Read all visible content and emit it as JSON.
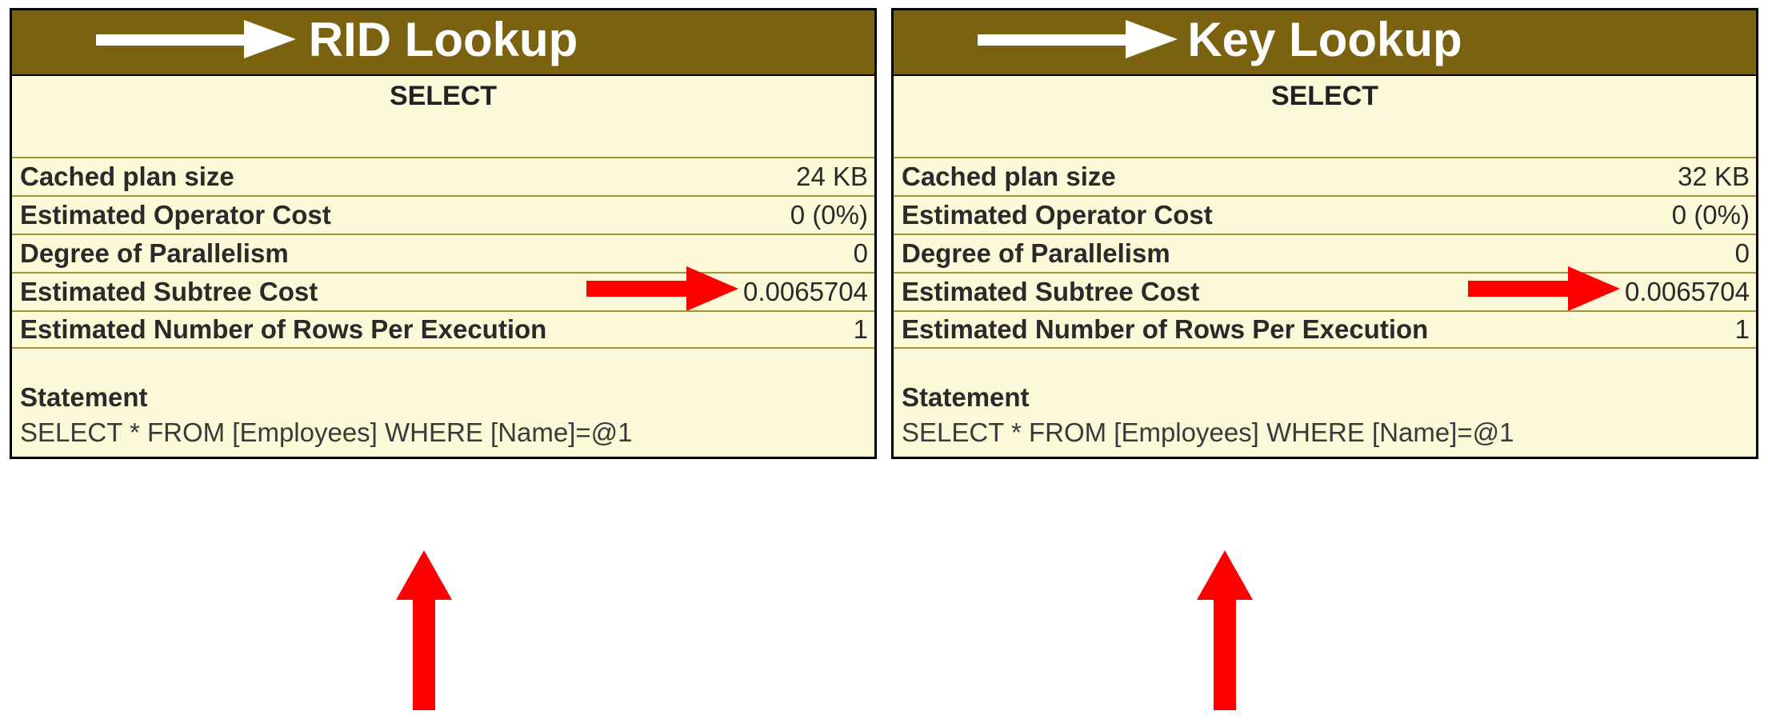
{
  "panels": [
    {
      "id": "rid",
      "title": "RID Lookup",
      "body_title": "SELECT",
      "rows": [
        {
          "label": "Cached plan size",
          "value": "24 KB"
        },
        {
          "label": "Estimated Operator Cost",
          "value": "0 (0%)"
        },
        {
          "label": "Degree of Parallelism",
          "value": "0"
        },
        {
          "label": "Estimated Subtree Cost",
          "value": "0.0065704",
          "highlight": true
        },
        {
          "label": "Estimated Number of Rows Per Execution",
          "value": "1"
        }
      ],
      "statement_label": "Statement",
      "statement_text": "SELECT * FROM [Employees] WHERE [Name]=@1"
    },
    {
      "id": "key",
      "title": "Key Lookup",
      "body_title": "SELECT",
      "rows": [
        {
          "label": "Cached plan size",
          "value": "32 KB"
        },
        {
          "label": "Estimated Operator Cost",
          "value": "0 (0%)"
        },
        {
          "label": "Degree of Parallelism",
          "value": "0"
        },
        {
          "label": "Estimated Subtree Cost",
          "value": "0.0065704",
          "highlight": true
        },
        {
          "label": "Estimated Number of Rows Per Execution",
          "value": "1"
        }
      ],
      "statement_label": "Statement",
      "statement_text": "SELECT * FROM [Employees] WHERE [Name]=@1"
    }
  ],
  "chart_data": {
    "type": "table",
    "title": "SQL Server Query Plan Property Comparison: RID Lookup vs Key Lookup",
    "categories": [
      "Cached plan size",
      "Estimated Operator Cost",
      "Degree of Parallelism",
      "Estimated Subtree Cost",
      "Estimated Number of Rows Per Execution",
      "Statement"
    ],
    "series": [
      {
        "name": "RID Lookup",
        "values": [
          "24 KB",
          "0 (0%)",
          0,
          0.0065704,
          1,
          "SELECT * FROM [Employees] WHERE [Name]=@1"
        ]
      },
      {
        "name": "Key Lookup",
        "values": [
          "32 KB",
          "0 (0%)",
          0,
          0.0065704,
          1,
          "SELECT * FROM [Employees] WHERE [Name]=@1"
        ]
      }
    ],
    "annotations": [
      {
        "target": "Estimated Subtree Cost",
        "type": "red-arrow-right"
      },
      {
        "target": "Statement",
        "type": "red-arrow-up"
      }
    ]
  }
}
